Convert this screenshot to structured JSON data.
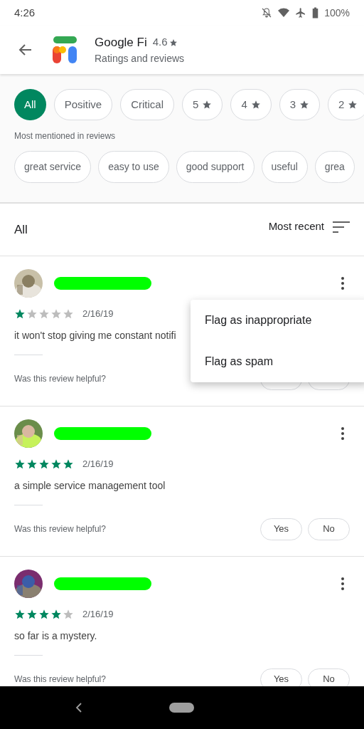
{
  "status_bar": {
    "time": "4:26",
    "battery": "100%"
  },
  "header": {
    "app_name": "Google Fi",
    "rating": "4.6",
    "subtitle": "Ratings and reviews"
  },
  "filters": [
    {
      "label": "All",
      "star": false,
      "selected": true
    },
    {
      "label": "Positive",
      "star": false,
      "selected": false
    },
    {
      "label": "Critical",
      "star": false,
      "selected": false
    },
    {
      "label": "5",
      "star": true,
      "selected": false
    },
    {
      "label": "4",
      "star": true,
      "selected": false
    },
    {
      "label": "3",
      "star": true,
      "selected": false
    },
    {
      "label": "2",
      "star": true,
      "selected": false
    }
  ],
  "mentions_heading": "Most mentioned in reviews",
  "mentions": [
    "great service",
    "easy to use",
    "good support",
    "useful",
    "grea"
  ],
  "list_header": {
    "title": "All",
    "sort": "Most recent"
  },
  "reviews": [
    {
      "stars": 1,
      "date": "2/16/19",
      "text": "it won't stop giving me constant notifi",
      "question": "Was this review helpful?"
    },
    {
      "stars": 5,
      "date": "2/16/19",
      "text": "a simple service management tool",
      "question": "Was this review helpful?",
      "yes": "Yes",
      "no": "No"
    },
    {
      "stars": 4,
      "date": "2/16/19",
      "text": "so far is a mystery.",
      "question": "Was this review helpful?",
      "yes": "Yes",
      "no": "No"
    }
  ],
  "menu": {
    "items": [
      "Flag as inappropriate",
      "Flag as spam"
    ]
  }
}
